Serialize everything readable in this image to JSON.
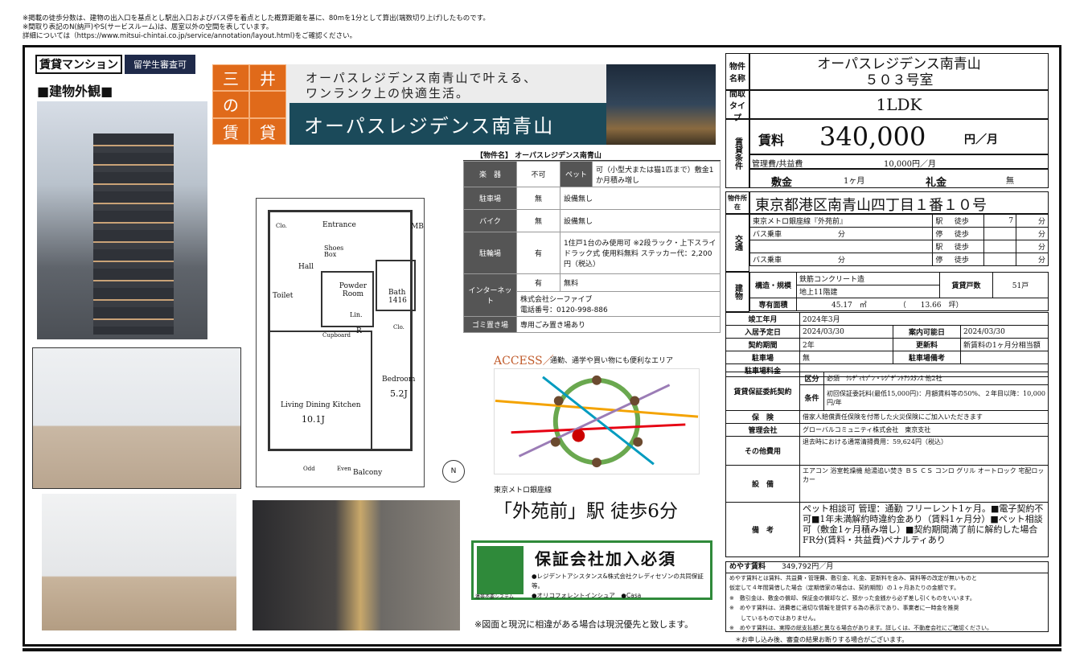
{
  "notes": [
    "※掲載の徒歩分数は、建物の出入口を基点とし駅出入口およびバス停を着点とした概算距離を基に、80mを1分として算出(端数切り上げ)したものです。",
    "※間取り表記のN(納戸)やS(サービスルーム)は、居室以外の空間を表しています。",
    "詳細については（https://www.mitsui-chintai.co.jp/service/annotation/layout.html)をご確認ください。"
  ],
  "tags": {
    "type": "賃貸マンション",
    "student": "留学生審査可"
  },
  "exterior_title": "■建物外観■",
  "banner": {
    "logo_chars": [
      "三",
      "井",
      "の",
      "賃",
      "貸",
      ""
    ],
    "catch_line1": "オーパスレジデンス南青山で叶える、",
    "catch_line2": "ワンランク上の快適生活。",
    "name": "オーパスレジデンス南青山"
  },
  "spec": {
    "header": "【物件名】 オーパスレジデンス南青山",
    "pet_label": "楽　器",
    "pet_value": "不可",
    "pet_key": "ペット",
    "pet_detail": "可（小型犬または猫1匹まで）敷金1か月積み増し",
    "rows": [
      {
        "label": "駐車場",
        "mark": "無",
        "detail": "設備無し"
      },
      {
        "label": "バイク",
        "mark": "無",
        "detail": "設備無し"
      },
      {
        "label": "駐輪場",
        "mark": "有",
        "detail": "1住戸1台のみ使用可 ※2段ラック・上下スライドラック式 使用料無料 ステッカー代：2,200円（税込）"
      },
      {
        "label": "インターネット",
        "mark": "有",
        "detail": "無料"
      },
      {
        "label": "ゴミ置き場",
        "mark": "",
        "detail": "専用ごみ置き場あり"
      }
    ],
    "isp": "株式会社シーファイブ",
    "isp_phone": "電話番号：0120-998-886"
  },
  "floorplan": {
    "entrance": "Entrance",
    "shoes": "Shoes Box",
    "mb": "MB",
    "clo": "Clo.",
    "hall": "Hall",
    "powder": "Powder Room",
    "bath": "Bath 1416",
    "toilet": "Toilet",
    "lin": "Lin.",
    "cupboard": "Cupboard",
    "r": "R",
    "clo2": "Clo.",
    "ldk": "Living Dining Kitchen",
    "ldk_size": "10.1J",
    "bedroom": "Bedroom",
    "bedroom_size": "5.2J",
    "balcony": "Balcony",
    "odd": "Odd",
    "even": "Even",
    "north": "N"
  },
  "access": {
    "title": "ACCESS／",
    "subtitle": "通勤、通学や買い物にも便利なエリア",
    "line": "東京メトロ銀座線",
    "station": "「外苑前」駅 徒歩6分"
  },
  "guarantee": {
    "title": "保証会社加入必須",
    "line1": "●レジデントアシスタンス&株式会社クレディセゾンの共同保証等。",
    "line2": "●オリコフォレントインシュア　●Casa",
    "caption": "連帯不要システム"
  },
  "disclaimer": "※図面と現況に相違がある場合は現況優先と致します。",
  "right": {
    "name_label": "物件名称",
    "name": "オーパスレジデンス南青山",
    "room": "５０３号室",
    "layout_label": "間取タイプ",
    "layout": "1LDK",
    "cond_label": "賃貸条件",
    "rent_label": "賃料",
    "rent": "340,000",
    "rent_unit": "円／月",
    "fee_label": "管理費/共益費",
    "fee": "10,000円／月",
    "deposit_label": "敷金",
    "deposit": "1ヶ月",
    "key_label": "礼金",
    "key": "無",
    "address_label": "物件所在",
    "address": "東京都港区南青山四丁目１番１０号",
    "traffic_label": "交通",
    "traffic": [
      {
        "line": "東京メトロ銀座線『外苑前』",
        "mid": "",
        "k1": "駅",
        "k2": "徒歩",
        "min": "7",
        "unit": "分"
      },
      {
        "line": "バス乗車",
        "mid": "分",
        "k1": "停",
        "k2": "徒歩",
        "min": "",
        "unit": "分"
      },
      {
        "line": "",
        "mid": "",
        "k1": "駅",
        "k2": "徒歩",
        "min": "",
        "unit": "分"
      },
      {
        "line": "バス乗車",
        "mid": "分",
        "k1": "停",
        "k2": "徒歩",
        "min": "",
        "unit": "分"
      }
    ],
    "bldg_label": "建物",
    "structure_label": "構造・規模",
    "structure1": "鉄筋コンクリート造",
    "structure2": "地上11階建",
    "units_label": "賃貸戸数",
    "units": "51戸",
    "area_label": "専有面積",
    "area_m2": "45.17　㎡",
    "area_tsubo": "（　　13.66　坪）",
    "built_label": "竣工年月",
    "built": "2024年3月",
    "movein_label": "入居予定日",
    "movein": "2024/03/30",
    "guide_label": "案内可能日",
    "guide": "2024/03/30",
    "term_label": "契約期間",
    "term": "2年",
    "renew_label": "更新料",
    "renew": "新賃料の1ヶ月分相当額",
    "parking_label": "駐車場",
    "parking": "無",
    "parking_eq_label": "駐車場備考",
    "parking_fee_label": "駐車場料金",
    "guarantor_label": "賃貸保証委託契約",
    "kubun_label": "区分",
    "kubun": "必須　ｸﾚﾃﾞｨｾｿﾞﾝ・ﾚｼﾞﾃﾞﾝﾄｱｼｽﾀﾝｽ 他2社",
    "jouken_label": "条件",
    "jouken": "初回保証委託料(最低15,000円)：月額賃料等の50%、２年目以降：10,000円/年",
    "insurance_label": "保　険",
    "insurance": "借家人賠償責任保険を付帯した火災保険にご加入いただきます",
    "mgmt_label": "管理会社",
    "mgmt": "グローバルコミュニティ株式会社　東京支社",
    "other_label": "その他費用",
    "other": "退去時における通常清掃費用：59,624円（税込）",
    "equip_label": "設　備",
    "equip": "エアコン 浴室乾燥機 給湯追い焚き ＢＳ ＣＳ コンロ グリル オートロック 宅配ロッカー",
    "remarks_label": "備　考",
    "remarks": "ペット相談可 管理：通勤 フリーレント1ヶ月。■電子契約不可■1年未満解約時違約金あり（賃料1ヶ月分）■ペット相談可（敷金1ヶ月積み増し）■契約期間満了前に解約した場合FR分(賃料・共益費)ペナルティあり",
    "meyasu_label": "めやす賃料",
    "meyasu": "349,792円／月",
    "meyasu_notes": [
      "めやす賃料とは賃料、共益費・管理費、敷引金、礼金、更新料を含み、賃料等の改定が無いものと",
      "仮定して４年間賃借した場合（定期借家の場合は、契約期間）の１ヶ月あたりの金額です。",
      "※　敷引金は、敷金の償却、保証金の償却など、預かった金銭から必ず差し引くものをいいます。",
      "※　めやす賃料は、消費者に適切な情報を提供する為の表示であり、事業者に一時金を推奨",
      "　　しているものではありません。",
      "※　めやす賃料は、実際の総支払額と異なる場合があります。詳しくは、不動産会社にご確認ください。"
    ],
    "footer": "＊お申し込み後、審査の結果お断りする場合がございます。"
  }
}
